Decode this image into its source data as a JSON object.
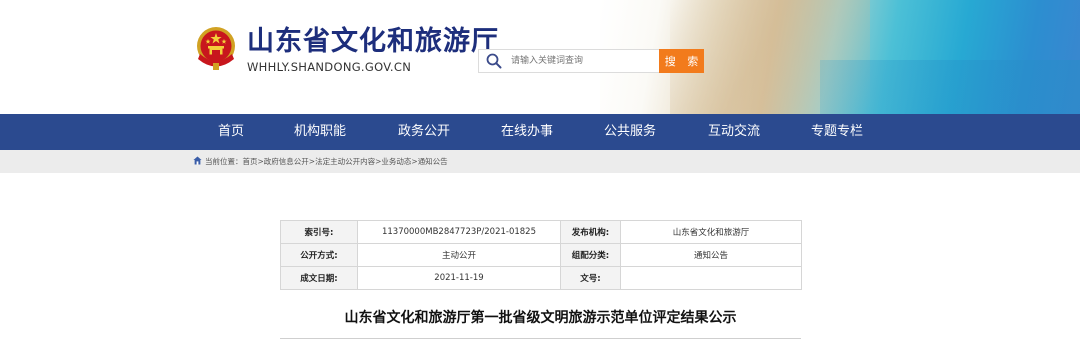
{
  "header": {
    "site_title": "山东省文化和旅游厅",
    "site_url": "WHHLY.SHANDONG.GOV.CN",
    "emblem_icon": "national-emblem-icon",
    "search": {
      "placeholder": "请输入关键词查询",
      "button_label": "搜 索"
    }
  },
  "nav": {
    "items": [
      "首页",
      "机构职能",
      "政务公开",
      "在线办事",
      "公共服务",
      "互动交流",
      "专题专栏"
    ]
  },
  "breadcrumb": {
    "prefix": "当前位置：",
    "items": [
      "首页",
      "政府信息公开",
      "法定主动公开内容",
      "业务动态",
      "通知公告"
    ],
    "separator": ">"
  },
  "info": {
    "index_label": "索引号:",
    "index_value": "11370000MB2847723P/2021-01825",
    "publisher_label": "发布机构:",
    "publisher_value": "山东省文化和旅游厅",
    "method_label": "公开方式:",
    "method_value": "主动公开",
    "category_label": "组配分类:",
    "category_value": "通知公告",
    "date_label": "成文日期:",
    "date_value": "2021-11-19",
    "docno_label": "文号:",
    "docno_value": ""
  },
  "article": {
    "title": "山东省文化和旅游厅第一批省级文明旅游示范单位评定结果公示"
  },
  "colors": {
    "nav_bg": "#2b4a8f",
    "title_color": "#1d2e7c",
    "search_button": "#f27b1c",
    "crumb_bg": "#ececec"
  }
}
